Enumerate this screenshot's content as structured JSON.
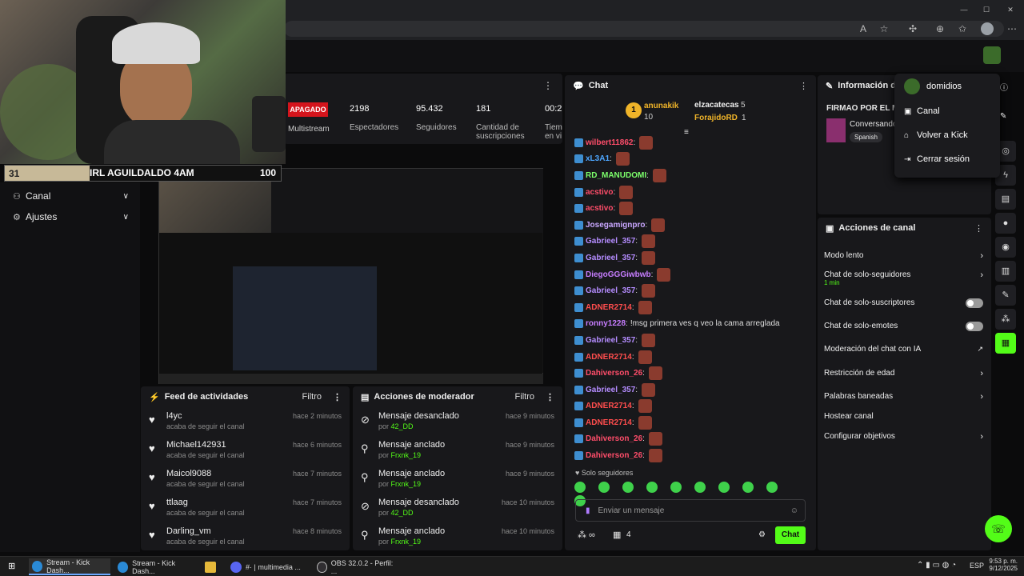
{
  "browser": {
    "icons": [
      "read-aloud-icon",
      "favorite-icon",
      "extensions-icon",
      "split-icon",
      "collections-icon",
      "profile-icon",
      "more-icon"
    ]
  },
  "webcam": {
    "goal_left": "31",
    "goal_title": "IRL AGUILDALDO 4AM",
    "goal_right": "100",
    "goal_progress": 0.31
  },
  "leftnav": {
    "items": [
      {
        "label": "Canal",
        "icon": "channel-icon"
      },
      {
        "label": "Ajustes",
        "icon": "gear-icon"
      }
    ]
  },
  "stats": {
    "status": "APAGADO",
    "multistream": "Multistream",
    "items": [
      {
        "value": "2198",
        "label": "Espectadores"
      },
      {
        "value": "95.432",
        "label": "Seguidores"
      },
      {
        "value": "181",
        "label": "Cantidad de suscripciones"
      },
      {
        "value": "00:2",
        "label": "Tiem en vi"
      }
    ]
  },
  "feed": {
    "title": "Feed de actividades",
    "filter": "Filtro",
    "items": [
      {
        "name": "l4yc",
        "sub": "acaba de seguir el canal",
        "time": "hace 2 minutos"
      },
      {
        "name": "Michael142931",
        "sub": "acaba de seguir el canal",
        "time": "hace 6 minutos"
      },
      {
        "name": "Maicol9088",
        "sub": "acaba de seguir el canal",
        "time": "hace 7 minutos"
      },
      {
        "name": "ttlaag",
        "sub": "acaba de seguir el canal",
        "time": "hace 7 minutos"
      },
      {
        "name": "Darling_vm",
        "sub": "acaba de seguir el canal",
        "time": "hace 8 minutos"
      }
    ]
  },
  "modactions": {
    "title": "Acciones de moderador",
    "filter": "Filtro",
    "items": [
      {
        "action": "Mensaje desanclado",
        "by": "por",
        "user": "42_DD",
        "time": "hace 9 minutos"
      },
      {
        "action": "Mensaje anclado",
        "by": "por",
        "user": "Frxnk_19",
        "time": "hace 9 minutos"
      },
      {
        "action": "Mensaje anclado",
        "by": "por",
        "user": "Frxnk_19",
        "time": "hace 9 minutos"
      },
      {
        "action": "Mensaje desanclado",
        "by": "por",
        "user": "42_DD",
        "time": "hace 10 minutos"
      },
      {
        "action": "Mensaje anclado",
        "by": "por",
        "user": "Frxnk_19",
        "time": "hace 10 minutos"
      }
    ]
  },
  "chat": {
    "title": "Chat",
    "leaderboard": [
      {
        "rank": "1",
        "name": "anunakik",
        "count": "10"
      },
      {
        "name": "elzacatecas",
        "count": "5"
      },
      {
        "name": "ForajidoRD",
        "count": "1"
      }
    ],
    "messages": [
      {
        "user": "wilbert11862",
        "color": "#ff4d6a",
        "text": ""
      },
      {
        "user": "xL3A1",
        "color": "#4da6ff",
        "text": ""
      },
      {
        "user": "RD_MANUDOMI",
        "color": "#7cff6b",
        "text": ""
      },
      {
        "user": "acstivo",
        "color": "#ff4d6a",
        "text": ""
      },
      {
        "user": "acstivo",
        "color": "#ff4d6a",
        "text": ""
      },
      {
        "user": "Josegamignpro",
        "color": "#c9a7ff",
        "text": ""
      },
      {
        "user": "Gabrieel_357",
        "color": "#b48cff",
        "text": ""
      },
      {
        "user": "Gabrieel_357",
        "color": "#b48cff",
        "text": ""
      },
      {
        "user": "DiegoGGGiwbwb",
        "color": "#c77dff",
        "text": ""
      },
      {
        "user": "Gabrieel_357",
        "color": "#b48cff",
        "text": ""
      },
      {
        "user": "ADNER2714",
        "color": "#ff4d4d",
        "text": ""
      },
      {
        "user": "ronny1228",
        "color": "#c77dff",
        "text": "!msg primera ves q veo la cama arreglada"
      },
      {
        "user": "Gabrieel_357",
        "color": "#b48cff",
        "text": ""
      },
      {
        "user": "ADNER2714",
        "color": "#ff4d4d",
        "text": ""
      },
      {
        "user": "Dahiverson_26",
        "color": "#ff4d6a",
        "text": ""
      },
      {
        "user": "Gabrieel_357",
        "color": "#b48cff",
        "text": ""
      },
      {
        "user": "ADNER2714",
        "color": "#ff4d4d",
        "text": ""
      },
      {
        "user": "ADNER2714",
        "color": "#ff4d4d",
        "text": ""
      },
      {
        "user": "Dahiverson_26",
        "color": "#ff4d6a",
        "text": ""
      },
      {
        "user": "Dahiverson_26",
        "color": "#ff4d6a",
        "text": ""
      }
    ],
    "followers_only": "Solo seguidores",
    "placeholder": "Enviar un mensaje",
    "count": "4",
    "send": "Chat"
  },
  "info": {
    "title": "Información del",
    "stream_title": "FIRMAO POR EL MI",
    "category": "Conversando",
    "language": "Spanish"
  },
  "actions": {
    "title": "Acciones de canal",
    "items": [
      {
        "label": "Modo lento",
        "kind": "chevron"
      },
      {
        "label": "Chat de solo-seguidores",
        "sub": "1 min",
        "kind": "chevron"
      },
      {
        "label": "Chat de solo-suscriptores",
        "kind": "toggle"
      },
      {
        "label": "Chat de solo-emotes",
        "kind": "toggle"
      },
      {
        "label": "Moderación del chat con IA",
        "kind": "external"
      },
      {
        "label": "Restricción de edad",
        "kind": "chevron"
      },
      {
        "label": "Palabras baneadas",
        "kind": "chevron"
      },
      {
        "label": "Hostear canal",
        "kind": "none"
      },
      {
        "label": "Configurar objetivos",
        "kind": "chevron"
      }
    ]
  },
  "menu": {
    "user": "domidios",
    "items": [
      {
        "label": "Canal",
        "icon": "channel-icon"
      },
      {
        "label": "Volver a Kick",
        "icon": "home-icon"
      },
      {
        "label": "Cerrar sesión",
        "icon": "logout-icon"
      }
    ]
  },
  "taskbar": {
    "items": [
      "Stream - Kick Dash...",
      "Stream - Kick Dash...",
      "",
      "#· | multimedia ...",
      "OBS 32.0.2 - Perfil: ..."
    ],
    "lang": "ESP",
    "time": "9:53 p. m.",
    "date": "9/12/2025"
  }
}
